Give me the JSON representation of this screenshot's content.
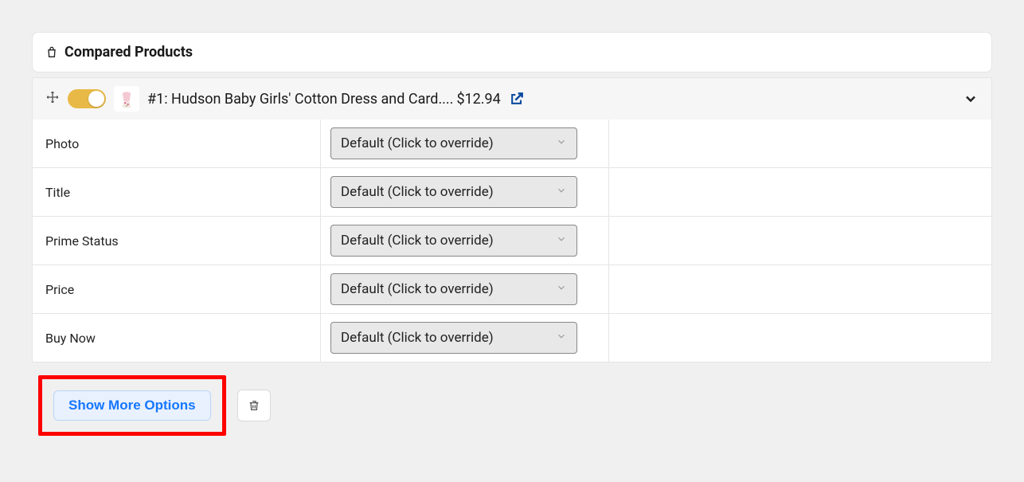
{
  "header": {
    "title": "Compared Products"
  },
  "product": {
    "rank_title": "#1: Hudson Baby Girls' Cotton Dress and Card....",
    "price": "$12.94"
  },
  "rows": [
    {
      "label": "Photo",
      "select": "Default (Click to override)"
    },
    {
      "label": "Title",
      "select": "Default (Click to override)"
    },
    {
      "label": "Prime Status",
      "select": "Default (Click to override)"
    },
    {
      "label": "Price",
      "select": "Default (Click to override)"
    },
    {
      "label": "Buy Now",
      "select": "Default (Click to override)"
    }
  ],
  "footer": {
    "show_more": "Show More Options"
  }
}
